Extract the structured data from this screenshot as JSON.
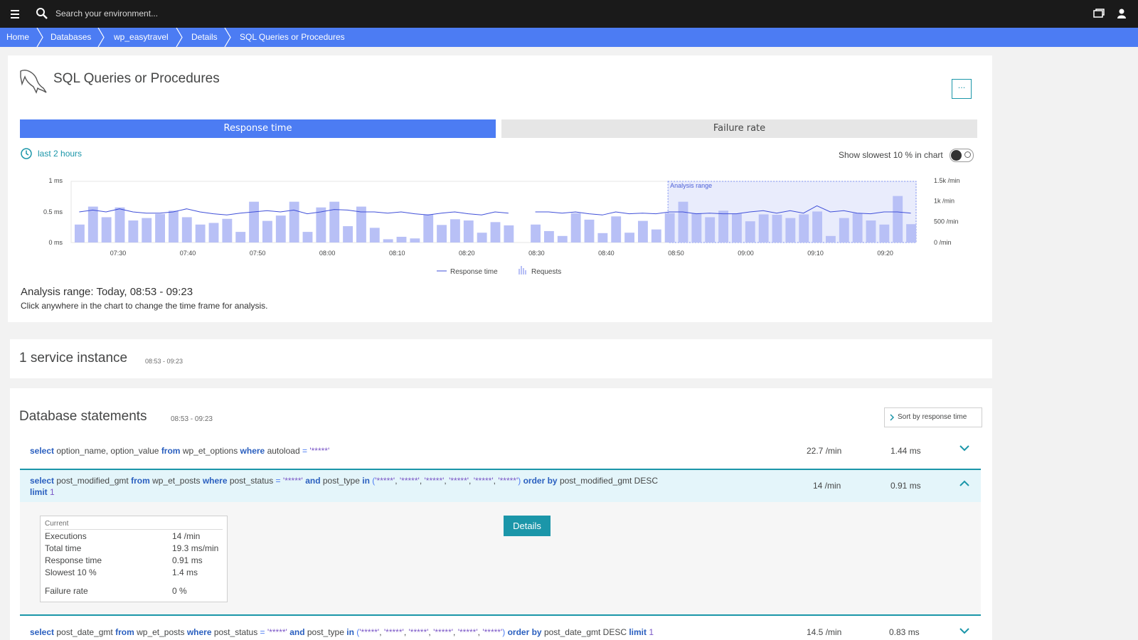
{
  "topbar": {
    "search_placeholder": "Search your environment..."
  },
  "breadcrumbs": [
    "Home",
    "Databases",
    "wp_easytravel",
    "Details",
    "SQL Queries or Procedures"
  ],
  "page": {
    "title": "SQL Queries or Procedures",
    "menu_button": "···",
    "tabs": [
      "Response time",
      "Failure rate"
    ],
    "timeframe": "last 2 hours",
    "slowest_toggle_label": "Show slowest 10 % in chart",
    "analysis_title": "Analysis range: Today, 08:53 - 09:23",
    "analysis_hint": "Click anywhere in the chart to change the time frame for analysis."
  },
  "chart_data": {
    "type": "bar",
    "x": [
      "07:30",
      "07:40",
      "07:50",
      "08:00",
      "08:10",
      "08:20",
      "08:30",
      "08:40",
      "08:50",
      "09:00",
      "09:10",
      "09:20"
    ],
    "left_axis_ticks": [
      "1 ms",
      "0.5 ms",
      "0 ms"
    ],
    "right_axis_ticks": [
      "1.5k /min",
      "1k /min",
      "500 /min",
      "0 /min"
    ],
    "ylim_left": [
      0,
      1
    ],
    "ylim_right": [
      0,
      1500
    ],
    "analysis_range_label": "Analysis range",
    "legend": [
      "Response time",
      "Requests"
    ],
    "requests_per_min": [
      440,
      880,
      620,
      860,
      540,
      600,
      700,
      780,
      620,
      440,
      480,
      580,
      260,
      1000,
      530,
      660,
      1000,
      260,
      860,
      1000,
      400,
      880,
      360,
      80,
      140,
      100,
      690,
      430,
      570,
      540,
      240,
      500,
      420,
      0,
      440,
      280,
      160,
      720,
      560,
      230,
      640,
      240,
      530,
      320,
      720,
      1000,
      720,
      620,
      780,
      710,
      520,
      690,
      680,
      600,
      690,
      760,
      160,
      600,
      720,
      540,
      440,
      1140,
      450
    ],
    "response_time_ms": [
      0.5,
      0.53,
      0.5,
      0.55,
      0.5,
      0.48,
      0.48,
      0.5,
      0.55,
      0.5,
      0.47,
      0.45,
      0.48,
      0.5,
      0.52,
      0.5,
      0.53,
      0.47,
      0.5,
      0.54,
      0.53,
      0.5,
      0.5,
      0.48,
      0.5,
      0.47,
      0.45,
      0.48,
      0.5,
      0.47,
      0.45,
      0.5,
      0.48,
      null,
      0.5,
      0.5,
      0.48,
      0.5,
      0.47,
      0.45,
      0.5,
      0.47,
      0.48,
      0.47,
      0.5,
      0.5,
      0.47,
      0.48,
      0.47,
      0.47,
      0.5,
      0.52,
      0.48,
      0.52,
      0.48,
      0.6,
      0.5,
      0.52,
      0.48,
      0.47,
      0.5,
      0.5,
      0.48
    ]
  },
  "instances": {
    "title": "1 service instance",
    "range": "08:53 - 09:23"
  },
  "statements": {
    "title": "Database statements",
    "range": "08:53 - 09:23",
    "sort_label": "Sort by response time",
    "rows": [
      {
        "rate": "22.7 /min",
        "time": "1.44 ms"
      },
      {
        "rate": "14 /min",
        "time": "0.91 ms"
      },
      {
        "rate": "14.5 /min",
        "time": "0.83 ms"
      }
    ],
    "details_button": "Details",
    "current_table": {
      "header": "Current",
      "rows": [
        [
          "Executions",
          "14 /min"
        ],
        [
          "Total time",
          "19.3 ms/min"
        ],
        [
          "Response time",
          "0.91 ms"
        ],
        [
          "Slowest 10 %",
          "1.4 ms"
        ],
        [
          "Failure rate",
          "0 %"
        ]
      ]
    }
  },
  "colors": {
    "accent": "#4c7cf3",
    "bars": "#b8c0f6",
    "line": "#3f4fd8",
    "details": "#1b96a9"
  }
}
